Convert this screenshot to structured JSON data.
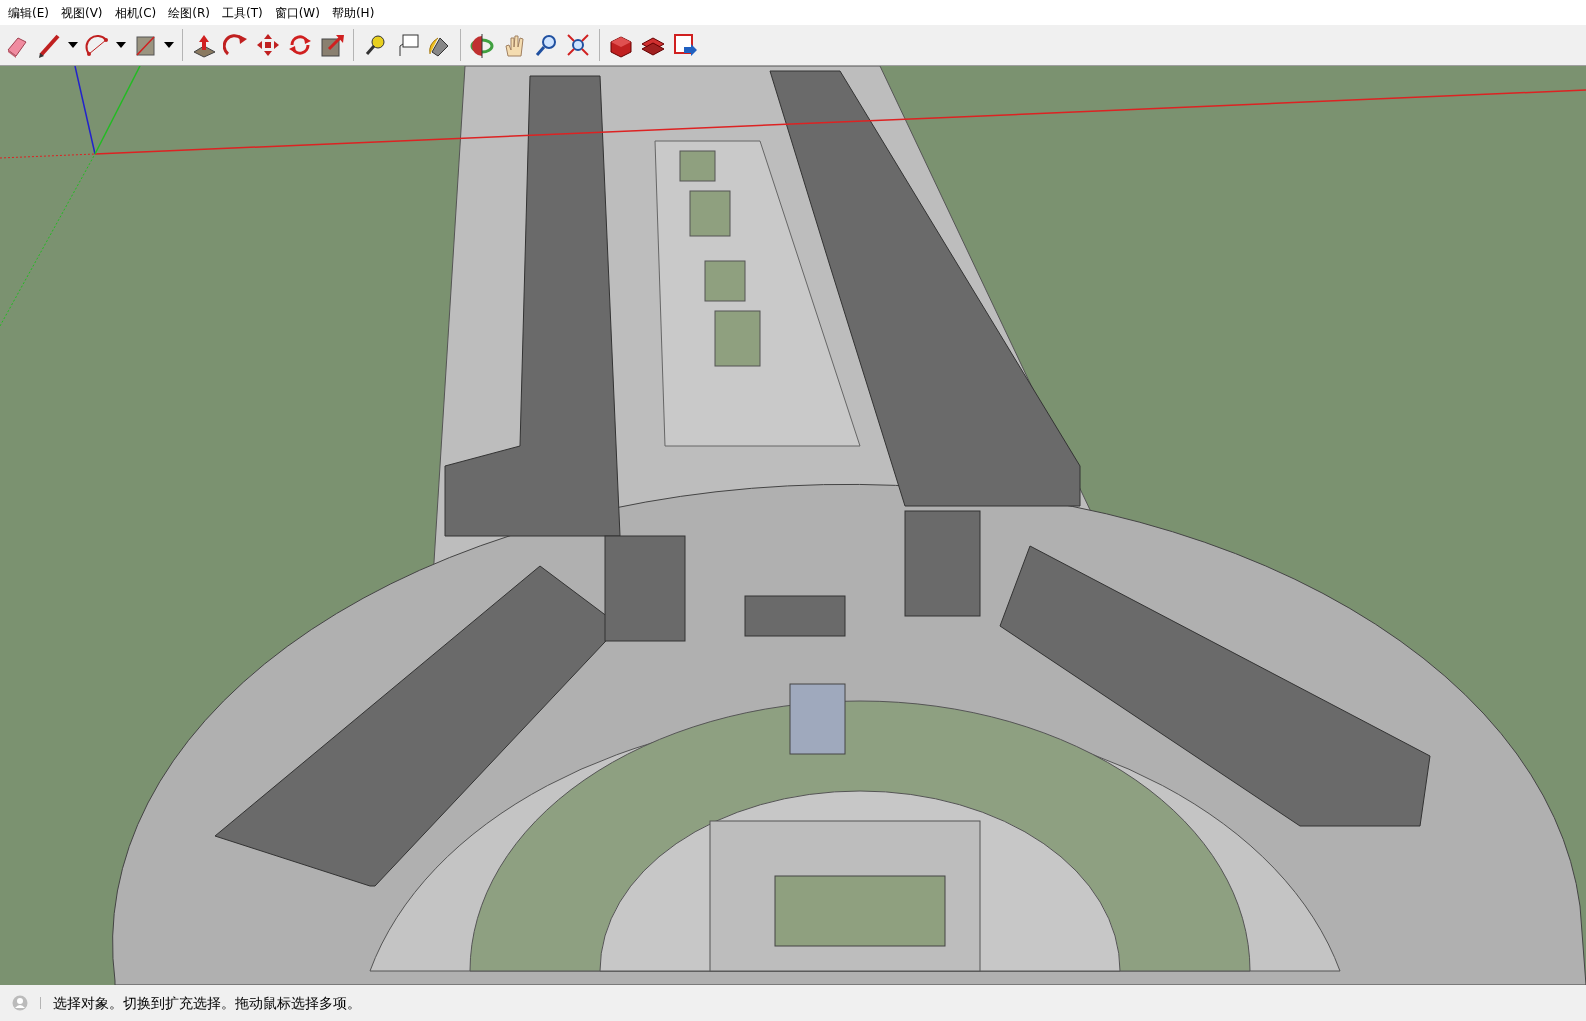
{
  "menu": [
    {
      "label": "编辑(E)"
    },
    {
      "label": "视图(V)"
    },
    {
      "label": "相机(C)"
    },
    {
      "label": "绘图(R)"
    },
    {
      "label": "工具(T)"
    },
    {
      "label": "窗口(W)"
    },
    {
      "label": "帮助(H)"
    }
  ],
  "status_bar": {
    "text": "选择对象。切换到扩充选择。拖动鼠标选择多项。"
  }
}
